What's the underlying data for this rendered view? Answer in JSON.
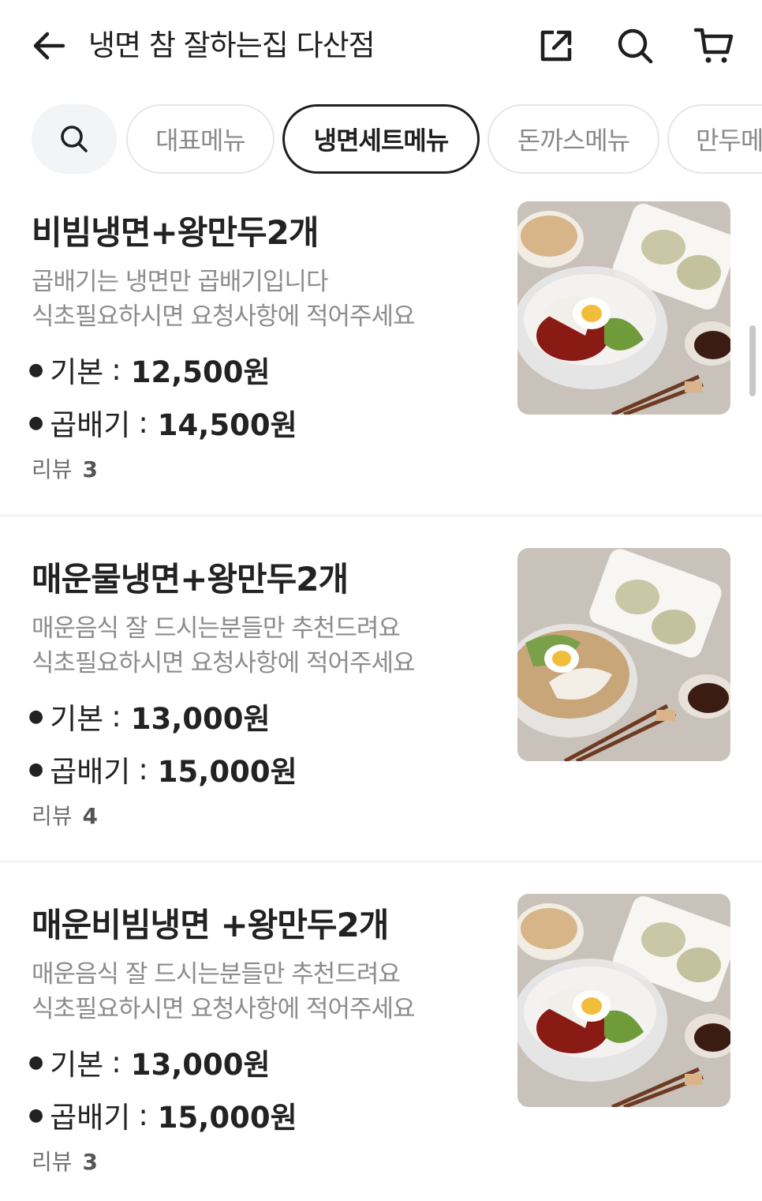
{
  "header": {
    "title": "냉면 참 잘하는집 다산점"
  },
  "tabs": [
    {
      "label": "대표메뉴"
    },
    {
      "label": "냉면세트메뉴"
    },
    {
      "label": "돈까스메뉴"
    },
    {
      "label": "만두메뉴"
    }
  ],
  "items": [
    {
      "name": "비빔냉면+왕만두2개",
      "desc1": "곱배기는 냉면만 곱배기입니다",
      "desc2": "식초필요하시면 요청사항에 적어주세요",
      "price_basic_label": "기본",
      "price_basic": "12,500원",
      "price_large_label": "곱배기",
      "price_large": "14,500원",
      "review_label": "리뷰",
      "review_count": "3"
    },
    {
      "name": "매운물냉면+왕만두2개",
      "desc1": "매운음식 잘 드시는분들만 추천드려요",
      "desc2": "식초필요하시면 요청사항에 적어주세요",
      "price_basic_label": "기본",
      "price_basic": "13,000원",
      "price_large_label": "곱배기",
      "price_large": "15,000원",
      "review_label": "리뷰",
      "review_count": "4"
    },
    {
      "name": "매운비빔냉면 +왕만두2개",
      "desc1": "매운음식 잘 드시는분들만 추천드려요",
      "desc2": "식초필요하시면 요청사항에 적어주세요",
      "price_basic_label": "기본",
      "price_basic": "13,000원",
      "price_large_label": "곱배기",
      "price_large": "15,000원",
      "review_label": "리뷰",
      "review_count": "3"
    }
  ],
  "colors": {
    "text": "#222222",
    "subtext": "#8c8c8c",
    "active_tab_border": "#1f1f1f",
    "tab_border": "#e6e6e6"
  }
}
